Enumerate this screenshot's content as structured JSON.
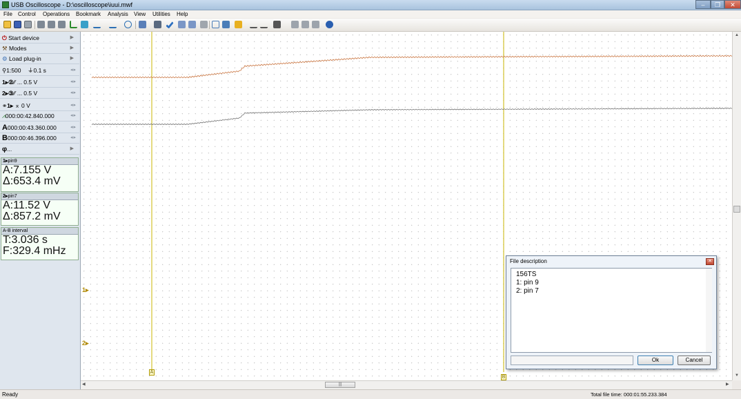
{
  "window": {
    "title": "USB Oscilloscope - D:\\oscilloscope\\iuui.mwf",
    "minimize": "–",
    "maximize": "❐",
    "close": "✕"
  },
  "menu": [
    "File",
    "Control",
    "Operations",
    "Bookmark",
    "Analysis",
    "View",
    "Utilities",
    "Help"
  ],
  "sidebar": {
    "start_device": "Start device",
    "modes": "Modes",
    "load_plugin": "Load plug-in",
    "timebase": "1:500",
    "time_per_div": "0.1 s",
    "ch1_scale": "... 0.5 V",
    "ch2_scale": "... 0.5 V",
    "trigger": "0 V",
    "trigger_time": "000:00:42.840.000",
    "cursor_a_time": "000:00:43.360.000",
    "cursor_b_time": "000:00:46.396.000",
    "phase": "..."
  },
  "measurements": [
    {
      "header": "pin9",
      "a_value": "A:7.155 V",
      "delta_value": "Δ:653.4 mV"
    },
    {
      "header": "pin7",
      "a_value": "A:11.52 V",
      "delta_value": "Δ:857.2 mV"
    },
    {
      "header": "A-B interval",
      "t_value": "T:3.036 s",
      "f_value": "F:329.4 mHz"
    }
  ],
  "scope": {
    "ch1_marker": "1",
    "ch2_marker": "2",
    "cursor_a": "A",
    "cursor_b": "B",
    "trace_colors": {
      "ch1": "#c8723c",
      "ch2": "#6e6e6e",
      "cursor": "#c8b400"
    }
  },
  "dialog": {
    "title": "File description",
    "lines": [
      "156TS",
      "1: pin 9",
      "2: pin 7"
    ],
    "ok": "Ok",
    "cancel": "Cancel"
  },
  "status": {
    "left": "Ready",
    "right": "Total file time: 000:01:55.233.384"
  }
}
